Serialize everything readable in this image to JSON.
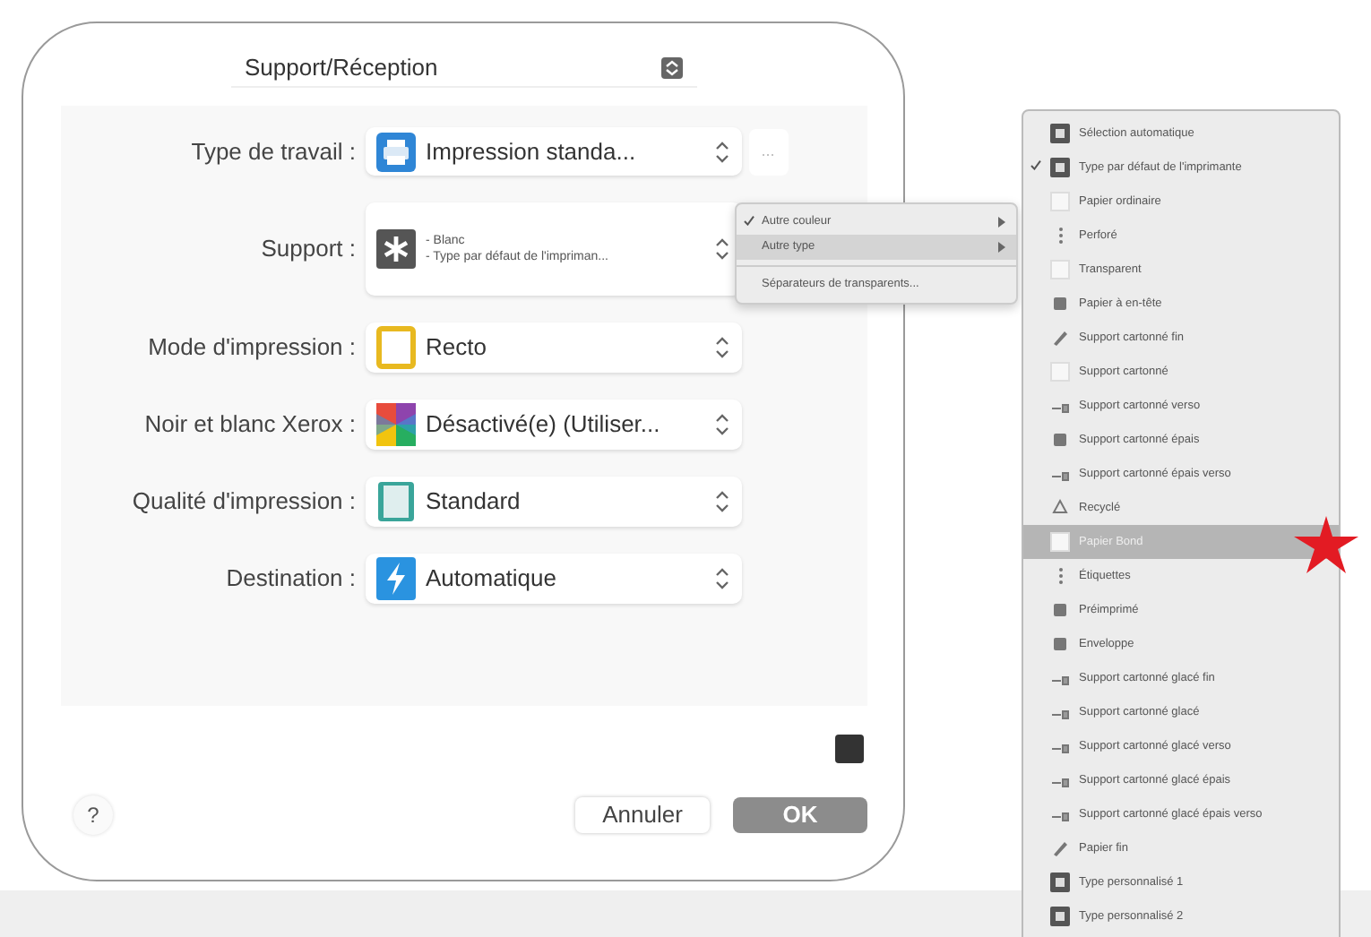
{
  "dialog": {
    "panel_selector": {
      "value": "Support/Réception"
    },
    "fields": [
      {
        "label": "Type de travail :",
        "kind": "printer",
        "values": [
          "Impression standa..."
        ],
        "extra_button": "..."
      },
      {
        "label": "Support :",
        "kind": "asterisk",
        "values": [
          "- Blanc",
          "- Type par défaut de l'impriman..."
        ]
      },
      {
        "label": "Mode d'impression :",
        "kind": "single-sided",
        "values": [
          "Recto"
        ]
      },
      {
        "label": "Noir et blanc Xerox :",
        "kind": "color-grid",
        "values": [
          "Désactivé(e) (Utiliser..."
        ]
      },
      {
        "label": "Qualité d'impression :",
        "kind": "page",
        "values": [
          "Standard"
        ]
      },
      {
        "label": "Destination :",
        "kind": "bolt",
        "values": [
          "Automatique"
        ]
      }
    ],
    "help_button": "?",
    "buttons": [
      {
        "label": "Annuler",
        "kind": "secondary"
      },
      {
        "label": "OK",
        "kind": "default"
      }
    ]
  },
  "context_menu": {
    "items": [
      {
        "kind": "item",
        "label": "Autre couleur",
        "checked": true,
        "selected": false,
        "submenu": true
      },
      {
        "kind": "item",
        "label": "Autre type",
        "checked": false,
        "selected": true,
        "submenu": true
      },
      {
        "kind": "separator"
      },
      {
        "kind": "item",
        "label": "Séparateurs de transparents...",
        "checked": false,
        "selected": false,
        "submenu": false
      }
    ]
  },
  "type_menu": {
    "items": [
      {
        "label": "Sélection automatique",
        "kind": "badge",
        "checked": false,
        "selected": false
      },
      {
        "label": "Type par défaut de l'imprimante",
        "kind": "badge",
        "checked": true,
        "selected": false
      },
      {
        "label": "Papier ordinaire",
        "kind": "sheet",
        "checked": false,
        "selected": false
      },
      {
        "label": "Perforé",
        "kind": "dots",
        "checked": false,
        "selected": false
      },
      {
        "label": "Transparent",
        "kind": "sheet",
        "checked": false,
        "selected": false
      },
      {
        "label": "Papier à en-tête",
        "kind": "block",
        "checked": false,
        "selected": false
      },
      {
        "label": "Support cartonné fin",
        "kind": "pen",
        "checked": false,
        "selected": false
      },
      {
        "label": "Support cartonné",
        "kind": "sheet",
        "checked": false,
        "selected": false
      },
      {
        "label": "Support cartonné verso",
        "kind": "glyph",
        "checked": false,
        "selected": false
      },
      {
        "label": "Support cartonné épais",
        "kind": "block",
        "checked": false,
        "selected": false
      },
      {
        "label": "Support cartonné épais verso",
        "kind": "glyph",
        "checked": false,
        "selected": false
      },
      {
        "label": "Recyclé",
        "kind": "recycle",
        "checked": false,
        "selected": false
      },
      {
        "label": "Papier Bond",
        "kind": "sheet",
        "checked": false,
        "selected": true
      },
      {
        "label": "Étiquettes",
        "kind": "dots",
        "checked": false,
        "selected": false
      },
      {
        "label": "Préimprimé",
        "kind": "block",
        "checked": false,
        "selected": false
      },
      {
        "label": "Enveloppe",
        "kind": "block",
        "checked": false,
        "selected": false
      },
      {
        "label": "Support cartonné glacé fin",
        "kind": "glyph",
        "checked": false,
        "selected": false
      },
      {
        "label": "Support cartonné glacé",
        "kind": "glyph",
        "checked": false,
        "selected": false
      },
      {
        "label": "Support cartonné glacé verso",
        "kind": "glyph",
        "checked": false,
        "selected": false
      },
      {
        "label": "Support cartonné glacé épais",
        "kind": "glyph",
        "checked": false,
        "selected": false
      },
      {
        "label": "Support cartonné glacé épais verso",
        "kind": "glyph",
        "checked": false,
        "selected": false
      },
      {
        "label": "Papier fin",
        "kind": "pen",
        "checked": false,
        "selected": false
      },
      {
        "label": "Type personnalisé 1",
        "kind": "badge",
        "checked": false,
        "selected": false
      },
      {
        "label": "Type personnalisé 2",
        "kind": "badge",
        "checked": false,
        "selected": false
      }
    ]
  }
}
